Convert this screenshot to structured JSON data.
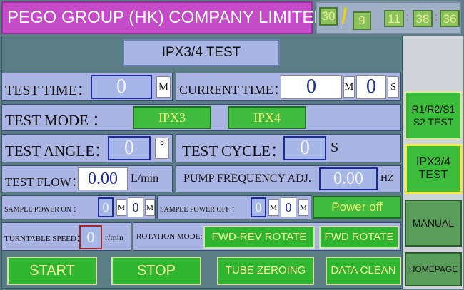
{
  "header": {
    "company": "PEGO GROUP (HK) COMPANY LIMITED",
    "date_day": "30",
    "date_month": "9",
    "date_sep": "/",
    "time_h": "11",
    "time_m": "38",
    "time_s": "36",
    "time_sep": ":"
  },
  "title": "IPX3/4 TEST",
  "test_time": {
    "label": "TEST TIME：",
    "value": "0",
    "unit": "M"
  },
  "current_time": {
    "label": "CURRENT TIME：",
    "value_m": "0",
    "unit_m": "M",
    "value_s": "0",
    "unit_s": "S"
  },
  "test_mode": {
    "label": "TEST MODE ：",
    "btn1": "IPX3",
    "btn2": "IPX4"
  },
  "test_angle": {
    "label": "TEST ANGLE：",
    "value": "0",
    "unit": "°"
  },
  "test_cycle": {
    "label": "TEST CYCLE：",
    "value": "0",
    "unit": "S"
  },
  "test_flow": {
    "label": "TEST FLOW：",
    "value": "0.00",
    "unit": "L/min"
  },
  "pump": {
    "label": "PUMP FREQUENCY ADJ.",
    "value": "0.00",
    "unit": "HZ"
  },
  "sample_on": {
    "label": "SAMPLE POWER ON ：",
    "value_m": "0",
    "unit_m": "M",
    "value_2": "0",
    "unit_2": "M"
  },
  "sample_off": {
    "label": "SAMPLE POWER OFF ：",
    "value_m": "0",
    "unit_m": "M",
    "value_2": "0",
    "unit_2": "M"
  },
  "power_btn": "Power off",
  "turntable": {
    "label": "TURNTABLE SPEED：",
    "value": "0",
    "unit": "r/min"
  },
  "rotation": {
    "label": "ROTATION MODE:",
    "btn1": "FWD-REV ROTATE",
    "btn2": "FWD ROTATE"
  },
  "bottom": {
    "start": "START",
    "stop": "STOP",
    "zero": "TUBE ZEROING",
    "clean": "DATA CLEAN"
  },
  "side": {
    "r1": "R1/R2/S1\nS2 TEST",
    "ipx": "IPX3/4\nTEST",
    "manual": "MANUAL",
    "home": "HOMEPAGE"
  },
  "colors": {
    "accent_green": "#3fbb3f",
    "value_blue": "#1c2aa0",
    "company_magenta": "#c64bc8"
  }
}
